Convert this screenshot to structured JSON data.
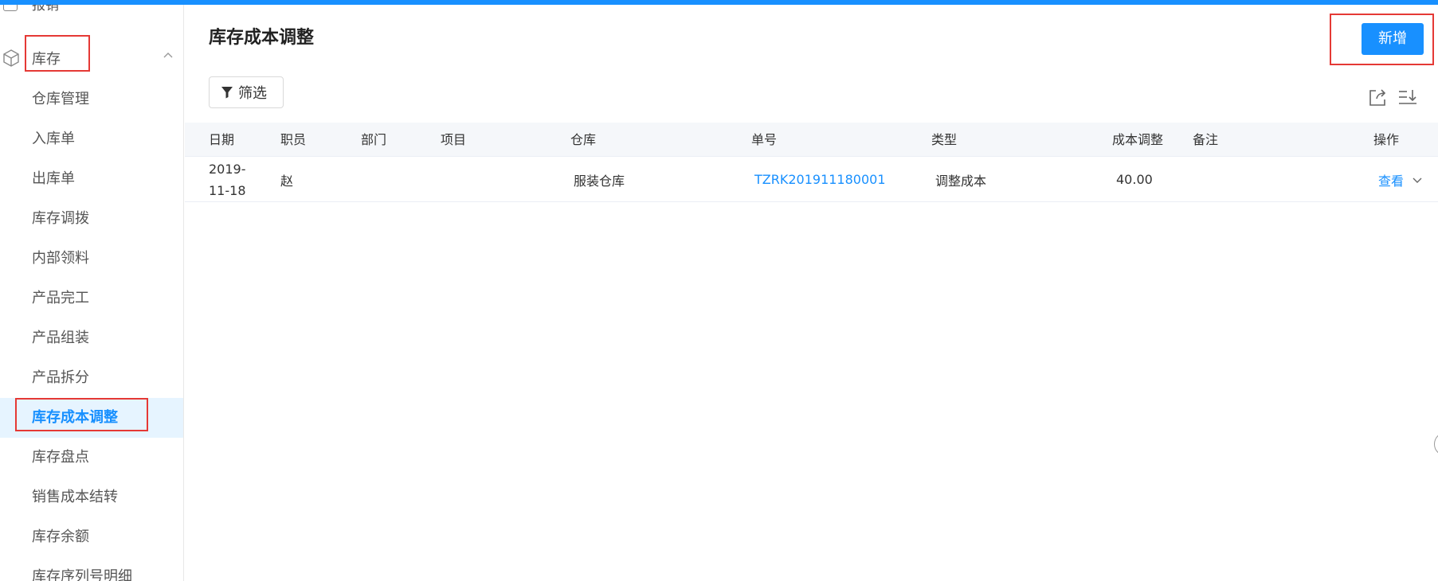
{
  "sidebar": {
    "prev_item_label": "报销",
    "group_label": "库存",
    "items": [
      {
        "label": "仓库管理"
      },
      {
        "label": "入库单"
      },
      {
        "label": "出库单"
      },
      {
        "label": "库存调拨"
      },
      {
        "label": "内部领料"
      },
      {
        "label": "产品完工"
      },
      {
        "label": "产品组装"
      },
      {
        "label": "产品拆分"
      },
      {
        "label": "库存成本调整",
        "active": true
      },
      {
        "label": "库存盘点"
      },
      {
        "label": "销售成本结转"
      },
      {
        "label": "库存余额"
      },
      {
        "label": "库存序列号明细"
      }
    ]
  },
  "page": {
    "title": "库存成本调整",
    "add_button": "新增",
    "filter_button": "筛选"
  },
  "table": {
    "columns": [
      "日期",
      "职员",
      "部门",
      "项目",
      "仓库",
      "单号",
      "类型",
      "成本调整",
      "备注",
      "操作"
    ],
    "rows": [
      {
        "date": "2019-11-18",
        "employee": "赵",
        "department": "",
        "project": "",
        "warehouse": "服装仓库",
        "number": "TZRK201911180001",
        "type": "调整成本",
        "cost_adjust": "40.00",
        "remark": "",
        "action": "查看"
      }
    ]
  },
  "colors": {
    "accent": "#1890ff",
    "highlight_box": "#e53935",
    "active_bg": "#e6f4ff"
  },
  "icons": [
    "cube-icon",
    "chevron-up-icon",
    "filter-icon",
    "export-icon",
    "sort-icon",
    "chevron-down-icon"
  ]
}
